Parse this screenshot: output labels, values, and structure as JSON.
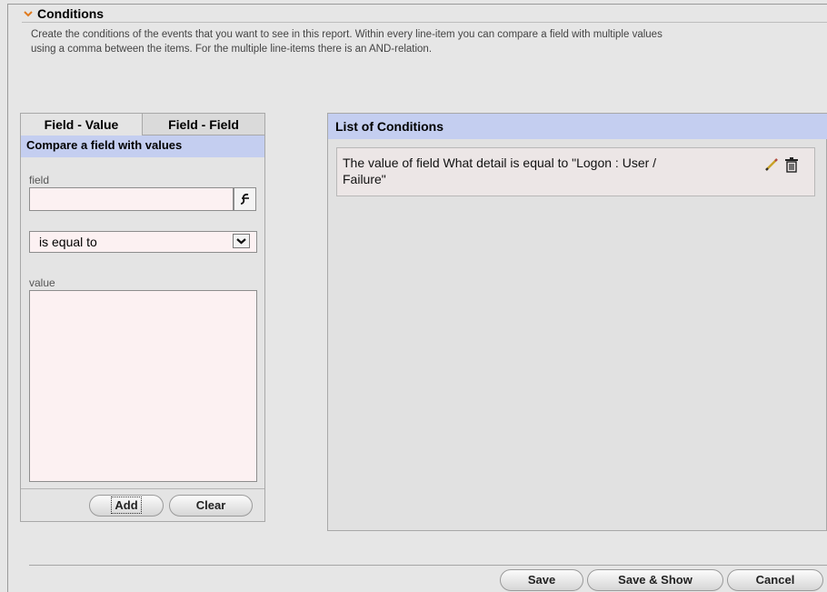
{
  "header": {
    "title": "Conditions",
    "description": "Create the conditions of the events that you want to see in this report. Within every line-item you can compare a field with multiple values using a comma between the items. For the multiple line-items there is an AND-relation."
  },
  "left_panel": {
    "tabs": [
      "Field - Value",
      "Field - Field"
    ],
    "subtitle": "Compare a field with values",
    "field_label": "field",
    "field_value": "",
    "operator": "is equal to",
    "value_label": "value",
    "value_text": "",
    "add_label": "Add",
    "clear_label": "Clear"
  },
  "right_panel": {
    "title": "List of Conditions",
    "conditions": [
      {
        "line1": "The value of field What detail is equal to \"Logon : User /",
        "line2": "Failure\""
      }
    ]
  },
  "footer": {
    "save_label": "Save",
    "save_show_label": "Save & Show",
    "cancel_label": "Cancel"
  },
  "icons": {
    "collapse": "chevron-down-icon",
    "field_picker": "field-picker-icon",
    "dropdown": "dropdown-arrow-icon",
    "edit": "pencil-icon",
    "delete": "trash-icon"
  },
  "colors": {
    "panel_header": "#c4cef0",
    "input_bg": "#fcf1f2",
    "accent_chevron": "#e07a1e"
  }
}
